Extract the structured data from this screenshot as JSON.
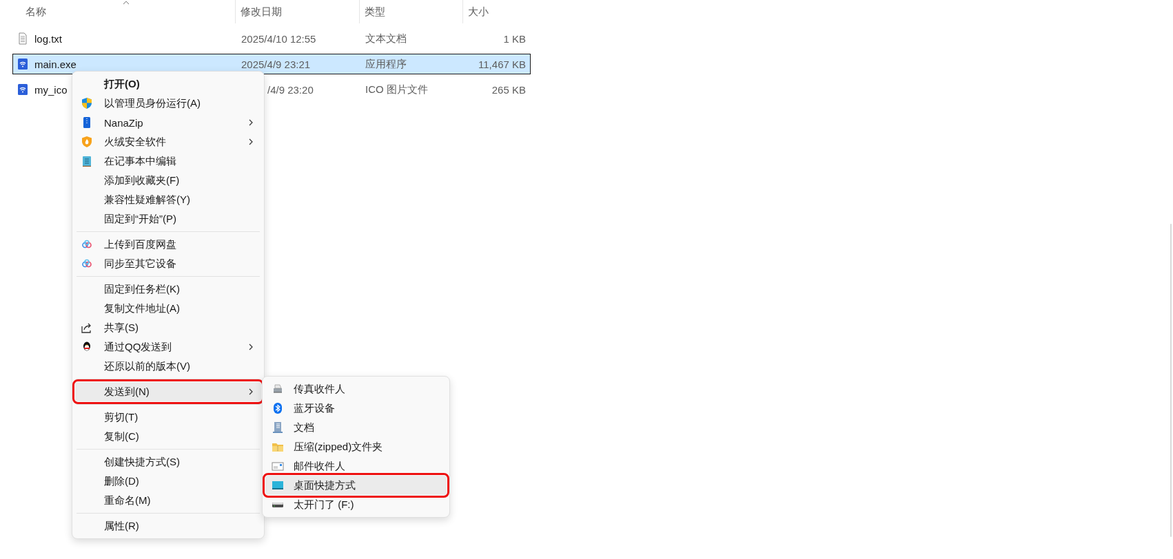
{
  "columns": [
    {
      "label": "名称",
      "sorted": true
    },
    {
      "label": "修改日期",
      "sorted": false
    },
    {
      "label": "类型",
      "sorted": false
    },
    {
      "label": "大小",
      "sorted": false
    }
  ],
  "files": [
    {
      "name": "log.txt",
      "date": "2025/4/10 12:55",
      "type": "文本文档",
      "size": "1 KB",
      "selected": false
    },
    {
      "name": "main.exe",
      "date": "2025/4/9 23:21",
      "type": "应用程序",
      "size": "11,467 KB",
      "selected": true
    },
    {
      "name": "my_ico",
      "date": "/4/9 23:20",
      "type": "ICO 图片文件",
      "size": "265 KB",
      "selected": false
    }
  ],
  "context_menu": {
    "groups": [
      [
        {
          "label": "打开(O)",
          "default": true,
          "submenu": false,
          "selected": false,
          "outlined": false
        },
        {
          "label": "以管理员身份运行(A)",
          "default": false,
          "submenu": false,
          "selected": false,
          "outlined": false
        },
        {
          "label": "NanaZip",
          "default": false,
          "submenu": true,
          "selected": false,
          "outlined": false
        },
        {
          "label": "火绒安全软件",
          "default": false,
          "submenu": true,
          "selected": false,
          "outlined": false
        },
        {
          "label": "在记事本中编辑",
          "default": false,
          "submenu": false,
          "selected": false,
          "outlined": false
        },
        {
          "label": "添加到收藏夹(F)",
          "default": false,
          "submenu": false,
          "selected": false,
          "outlined": false
        },
        {
          "label": "兼容性疑难解答(Y)",
          "default": false,
          "submenu": false,
          "selected": false,
          "outlined": false
        },
        {
          "label": "固定到“开始”(P)",
          "default": false,
          "submenu": false,
          "selected": false,
          "outlined": false
        }
      ],
      [
        {
          "label": "上传到百度网盘",
          "default": false,
          "submenu": false,
          "selected": false,
          "outlined": false
        },
        {
          "label": "同步至其它设备",
          "default": false,
          "submenu": false,
          "selected": false,
          "outlined": false
        }
      ],
      [
        {
          "label": "固定到任务栏(K)",
          "default": false,
          "submenu": false,
          "selected": false,
          "outlined": false
        },
        {
          "label": "复制文件地址(A)",
          "default": false,
          "submenu": false,
          "selected": false,
          "outlined": false
        },
        {
          "label": "共享(S)",
          "default": false,
          "submenu": false,
          "selected": false,
          "outlined": false
        },
        {
          "label": "通过QQ发送到",
          "default": false,
          "submenu": true,
          "selected": false,
          "outlined": false
        },
        {
          "label": "还原以前的版本(V)",
          "default": false,
          "submenu": false,
          "selected": false,
          "outlined": false
        }
      ],
      [
        {
          "label": "发送到(N)",
          "default": false,
          "submenu": true,
          "selected": true,
          "outlined": true
        }
      ],
      [
        {
          "label": "剪切(T)",
          "default": false,
          "submenu": false,
          "selected": false,
          "outlined": false
        },
        {
          "label": "复制(C)",
          "default": false,
          "submenu": false,
          "selected": false,
          "outlined": false
        }
      ],
      [
        {
          "label": "创建快捷方式(S)",
          "default": false,
          "submenu": false,
          "selected": false,
          "outlined": false
        },
        {
          "label": "删除(D)",
          "default": false,
          "submenu": false,
          "selected": false,
          "outlined": false
        },
        {
          "label": "重命名(M)",
          "default": false,
          "submenu": false,
          "selected": false,
          "outlined": false
        }
      ],
      [
        {
          "label": "属性(R)",
          "default": false,
          "submenu": false,
          "selected": false,
          "outlined": false
        }
      ]
    ]
  },
  "send_to_menu": {
    "items": [
      {
        "label": "传真收件人",
        "selected": false,
        "outlined": false
      },
      {
        "label": "蓝牙设备",
        "selected": false,
        "outlined": false
      },
      {
        "label": "文档",
        "selected": false,
        "outlined": false
      },
      {
        "label": "压缩(zipped)文件夹",
        "selected": false,
        "outlined": false
      },
      {
        "label": "邮件收件人",
        "selected": false,
        "outlined": false
      },
      {
        "label": "桌面快捷方式",
        "selected": true,
        "outlined": true
      },
      {
        "label": "太开门了 (F:)",
        "selected": false,
        "outlined": false
      }
    ]
  }
}
